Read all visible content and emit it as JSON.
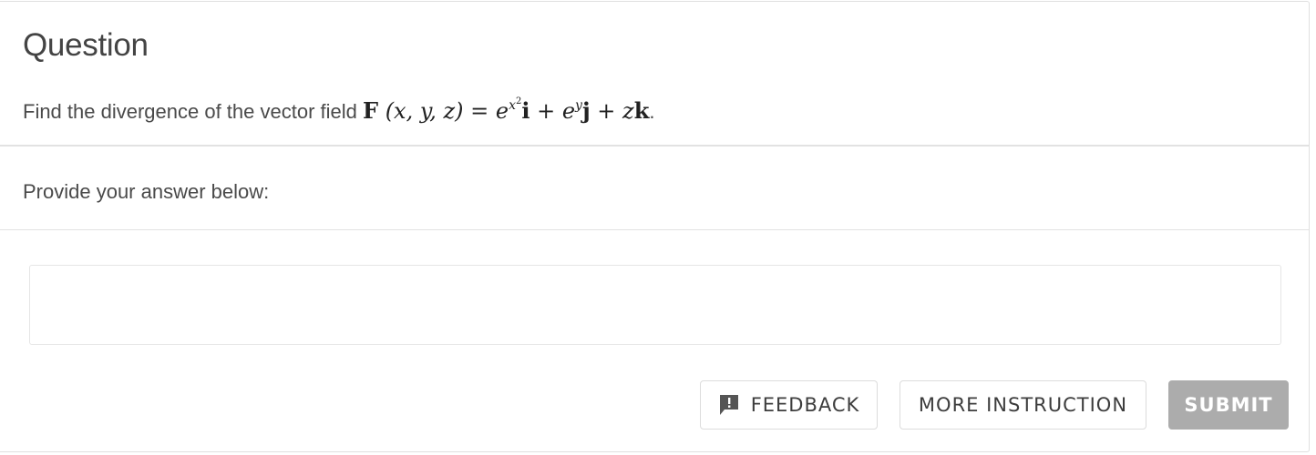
{
  "question": {
    "title": "Question",
    "text_prefix": "Find the divergence of the vector field ",
    "math": {
      "F": "F",
      "args": "(x, y, z)",
      "equals": " = ",
      "e1": "e",
      "exp1_base": "x",
      "exp1_pow": "2",
      "i": "i",
      "plus1": " + ",
      "e2": "e",
      "exp2": "y",
      "j": "j",
      "plus2": " + ",
      "z": "z",
      "k": "k"
    },
    "text_suffix": "."
  },
  "answer": {
    "prompt": "Provide your answer below:",
    "value": "",
    "placeholder": ""
  },
  "buttons": {
    "feedback_label": "FEEDBACK",
    "feedback_icon": "feedback-exclamation-icon",
    "more_instruction_label": "MORE INSTRUCTION",
    "submit_label": "SUBMIT"
  },
  "colors": {
    "submit_disabled_bg": "#acacac",
    "border": "#e0e0e0",
    "text": "#4a4a4a"
  }
}
